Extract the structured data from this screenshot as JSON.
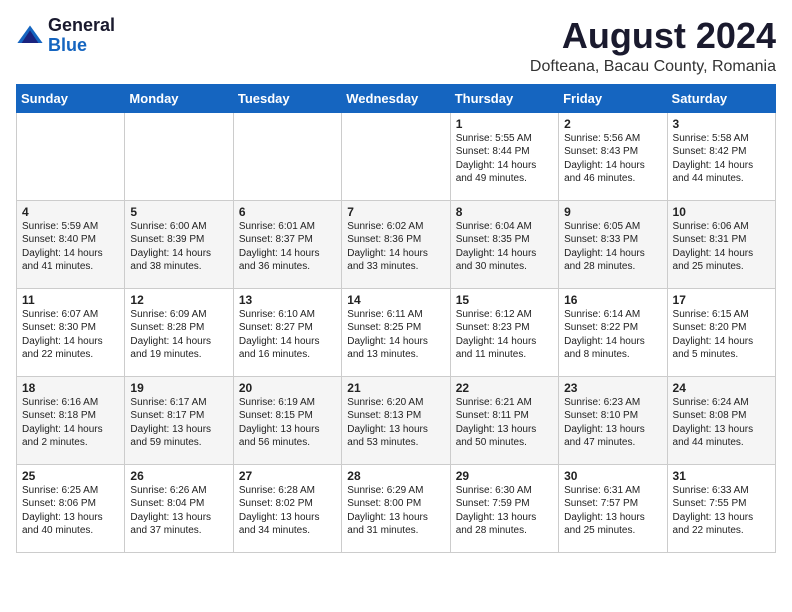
{
  "logo": {
    "general": "General",
    "blue": "Blue"
  },
  "calendar": {
    "title": "August 2024",
    "subtitle": "Dofteana, Bacau County, Romania"
  },
  "headers": [
    "Sunday",
    "Monday",
    "Tuesday",
    "Wednesday",
    "Thursday",
    "Friday",
    "Saturday"
  ],
  "weeks": [
    [
      {
        "day": "",
        "info": ""
      },
      {
        "day": "",
        "info": ""
      },
      {
        "day": "",
        "info": ""
      },
      {
        "day": "",
        "info": ""
      },
      {
        "day": "1",
        "info": "Sunrise: 5:55 AM\nSunset: 8:44 PM\nDaylight: 14 hours\nand 49 minutes."
      },
      {
        "day": "2",
        "info": "Sunrise: 5:56 AM\nSunset: 8:43 PM\nDaylight: 14 hours\nand 46 minutes."
      },
      {
        "day": "3",
        "info": "Sunrise: 5:58 AM\nSunset: 8:42 PM\nDaylight: 14 hours\nand 44 minutes."
      }
    ],
    [
      {
        "day": "4",
        "info": "Sunrise: 5:59 AM\nSunset: 8:40 PM\nDaylight: 14 hours\nand 41 minutes."
      },
      {
        "day": "5",
        "info": "Sunrise: 6:00 AM\nSunset: 8:39 PM\nDaylight: 14 hours\nand 38 minutes."
      },
      {
        "day": "6",
        "info": "Sunrise: 6:01 AM\nSunset: 8:37 PM\nDaylight: 14 hours\nand 36 minutes."
      },
      {
        "day": "7",
        "info": "Sunrise: 6:02 AM\nSunset: 8:36 PM\nDaylight: 14 hours\nand 33 minutes."
      },
      {
        "day": "8",
        "info": "Sunrise: 6:04 AM\nSunset: 8:35 PM\nDaylight: 14 hours\nand 30 minutes."
      },
      {
        "day": "9",
        "info": "Sunrise: 6:05 AM\nSunset: 8:33 PM\nDaylight: 14 hours\nand 28 minutes."
      },
      {
        "day": "10",
        "info": "Sunrise: 6:06 AM\nSunset: 8:31 PM\nDaylight: 14 hours\nand 25 minutes."
      }
    ],
    [
      {
        "day": "11",
        "info": "Sunrise: 6:07 AM\nSunset: 8:30 PM\nDaylight: 14 hours\nand 22 minutes."
      },
      {
        "day": "12",
        "info": "Sunrise: 6:09 AM\nSunset: 8:28 PM\nDaylight: 14 hours\nand 19 minutes."
      },
      {
        "day": "13",
        "info": "Sunrise: 6:10 AM\nSunset: 8:27 PM\nDaylight: 14 hours\nand 16 minutes."
      },
      {
        "day": "14",
        "info": "Sunrise: 6:11 AM\nSunset: 8:25 PM\nDaylight: 14 hours\nand 13 minutes."
      },
      {
        "day": "15",
        "info": "Sunrise: 6:12 AM\nSunset: 8:23 PM\nDaylight: 14 hours\nand 11 minutes."
      },
      {
        "day": "16",
        "info": "Sunrise: 6:14 AM\nSunset: 8:22 PM\nDaylight: 14 hours\nand 8 minutes."
      },
      {
        "day": "17",
        "info": "Sunrise: 6:15 AM\nSunset: 8:20 PM\nDaylight: 14 hours\nand 5 minutes."
      }
    ],
    [
      {
        "day": "18",
        "info": "Sunrise: 6:16 AM\nSunset: 8:18 PM\nDaylight: 14 hours\nand 2 minutes."
      },
      {
        "day": "19",
        "info": "Sunrise: 6:17 AM\nSunset: 8:17 PM\nDaylight: 13 hours\nand 59 minutes."
      },
      {
        "day": "20",
        "info": "Sunrise: 6:19 AM\nSunset: 8:15 PM\nDaylight: 13 hours\nand 56 minutes."
      },
      {
        "day": "21",
        "info": "Sunrise: 6:20 AM\nSunset: 8:13 PM\nDaylight: 13 hours\nand 53 minutes."
      },
      {
        "day": "22",
        "info": "Sunrise: 6:21 AM\nSunset: 8:11 PM\nDaylight: 13 hours\nand 50 minutes."
      },
      {
        "day": "23",
        "info": "Sunrise: 6:23 AM\nSunset: 8:10 PM\nDaylight: 13 hours\nand 47 minutes."
      },
      {
        "day": "24",
        "info": "Sunrise: 6:24 AM\nSunset: 8:08 PM\nDaylight: 13 hours\nand 44 minutes."
      }
    ],
    [
      {
        "day": "25",
        "info": "Sunrise: 6:25 AM\nSunset: 8:06 PM\nDaylight: 13 hours\nand 40 minutes."
      },
      {
        "day": "26",
        "info": "Sunrise: 6:26 AM\nSunset: 8:04 PM\nDaylight: 13 hours\nand 37 minutes."
      },
      {
        "day": "27",
        "info": "Sunrise: 6:28 AM\nSunset: 8:02 PM\nDaylight: 13 hours\nand 34 minutes."
      },
      {
        "day": "28",
        "info": "Sunrise: 6:29 AM\nSunset: 8:00 PM\nDaylight: 13 hours\nand 31 minutes."
      },
      {
        "day": "29",
        "info": "Sunrise: 6:30 AM\nSunset: 7:59 PM\nDaylight: 13 hours\nand 28 minutes."
      },
      {
        "day": "30",
        "info": "Sunrise: 6:31 AM\nSunset: 7:57 PM\nDaylight: 13 hours\nand 25 minutes."
      },
      {
        "day": "31",
        "info": "Sunrise: 6:33 AM\nSunset: 7:55 PM\nDaylight: 13 hours\nand 22 minutes."
      }
    ]
  ]
}
